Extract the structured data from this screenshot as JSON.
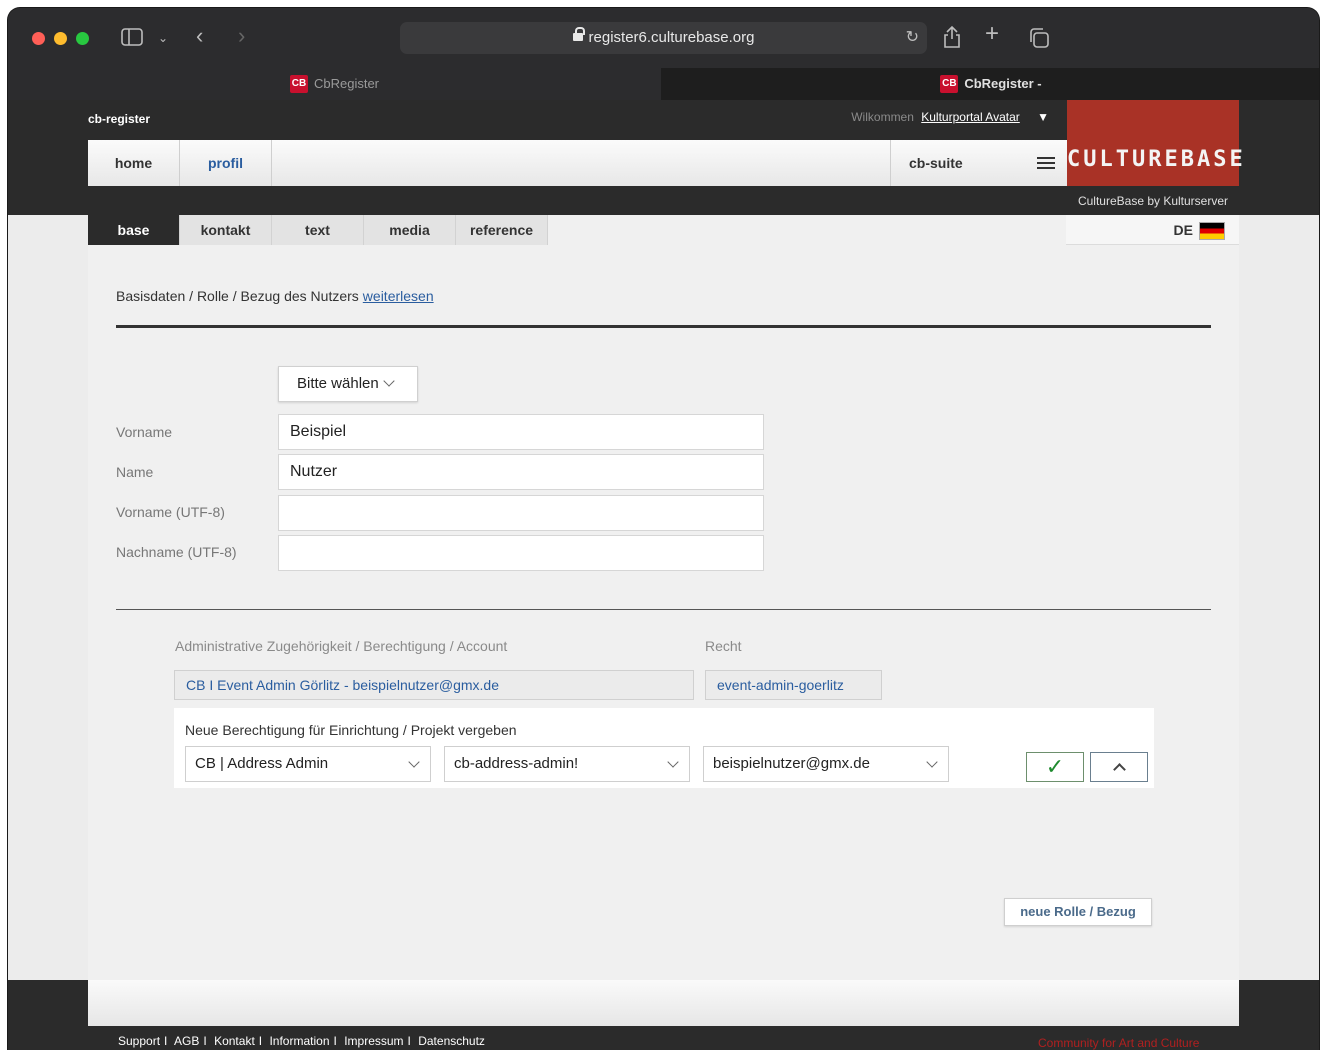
{
  "browser": {
    "url": "register6.culturebase.org",
    "tabs": [
      {
        "title": "CbRegister"
      },
      {
        "title": "CbRegister -"
      }
    ],
    "tab_logo": "CB"
  },
  "header": {
    "app_name": "cb-register",
    "welcome_text": "Wilkommen",
    "user_name": "Kulturportal Avatar",
    "brand": "CULTUREBASE",
    "brand_sub": "CultureBase by Kulturserver"
  },
  "nav": {
    "home": "home",
    "profil": "profil",
    "suite": "cb-suite"
  },
  "subtabs": [
    "base",
    "kontakt",
    "text",
    "media",
    "reference"
  ],
  "language": "DE",
  "intro": {
    "text": "Basisdaten / Rolle / Bezug des Nutzers",
    "link": "weiterlesen"
  },
  "form": {
    "salutation_select": "Bitte wählen",
    "fields": [
      {
        "label": "Vorname",
        "value": "Beispiel"
      },
      {
        "label": "Name",
        "value": "Nutzer"
      },
      {
        "label": "Vorname (UTF-8)",
        "value": ""
      },
      {
        "label": "Nachname (UTF-8)",
        "value": ""
      }
    ]
  },
  "admin": {
    "heading_account": "Administrative Zugehörigkeit / Berechtigung / Account",
    "heading_right": "Recht",
    "account_value": "CB I Event Admin Görlitz - beispielnutzer@gmx.de",
    "right_value": "event-admin-goerlitz"
  },
  "permission": {
    "title": "Neue Berechtigung für Einrichtung / Projekt vergeben",
    "select_role": "CB | Address Admin",
    "select_right": "cb-address-admin!",
    "select_account": "beispielnutzer@gmx.de",
    "ok_symbol": "✓",
    "new_role_button": "neue Rolle / Bezug"
  },
  "footer": {
    "links": [
      "Support",
      "AGB",
      "Kontakt",
      "Information",
      "Impressum",
      "Datenschutz"
    ],
    "separator": "I",
    "tagline": "Community for Art and Culture"
  }
}
